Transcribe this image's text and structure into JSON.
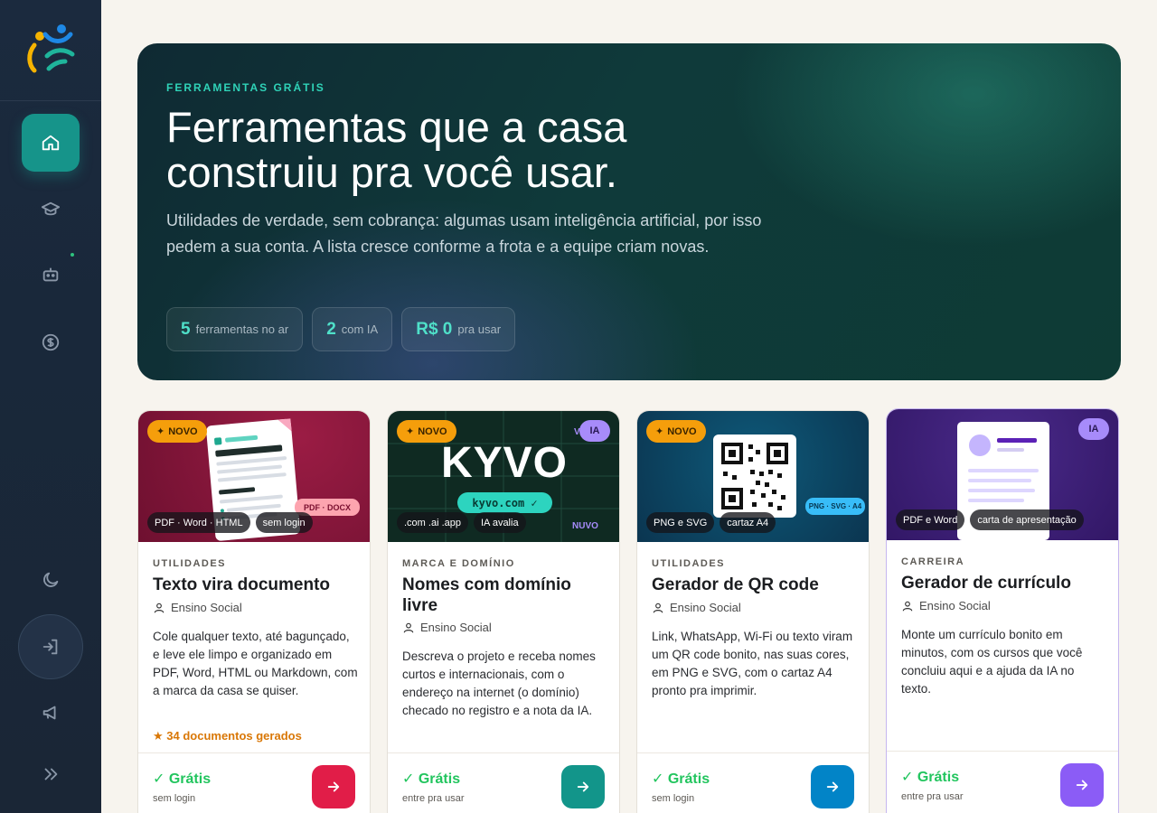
{
  "colors": {
    "accent": "#16948a",
    "price": "#22c55e",
    "badge_new": "#f59e0b",
    "badge_ia": "#a78bfa"
  },
  "sidebar": {
    "items": [
      {
        "icon": "home-icon",
        "active": true
      },
      {
        "icon": "graduation-cap-icon"
      },
      {
        "icon": "robot-icon"
      },
      {
        "icon": "dollar-icon"
      }
    ],
    "bottom": [
      "moon-icon",
      "logout-icon",
      "megaphone-icon",
      "chevrons-right-icon"
    ]
  },
  "hero": {
    "eyebrow": "FERRAMENTAS GRÁTIS",
    "title_line1": "Ferramentas que a casa",
    "title_line2": "construiu pra você usar.",
    "subtitle": "Utilidades de verdade, sem cobrança: algumas usam inteligência artificial, por isso pedem a sua conta. A lista cresce conforme a frota e a equipe criam novas.",
    "stats": [
      {
        "value": "5",
        "label": "ferramentas no ar"
      },
      {
        "value": "2",
        "label": "com IA"
      },
      {
        "value": "R$ 0",
        "label": "pra usar"
      }
    ]
  },
  "cards": [
    {
      "badge": "NOVO",
      "chips": [
        "PDF · Word · HTML",
        "sem login"
      ],
      "banner_tag": "PDF · DOCX",
      "category": "UTILIDADES",
      "title": "Texto vira documento",
      "author": "Ensino Social",
      "description": "Cole qualquer texto, até bagunçado, e leve ele limpo e organizado em PDF, Word, HTML ou Markdown, com a marca da casa se quiser.",
      "stat": "★ 34 documentos gerados",
      "price": "✓ Grátis",
      "note": "sem login",
      "button_color": "#e11d48"
    },
    {
      "badge": "NOVO",
      "ia": "IA",
      "brand": "KYVO",
      "domain_pill": "kyvo.com ✓",
      "side_text_top": "V",
      "side_text_bottom": "NUVO",
      "chips": [
        ".com .ai .app",
        "IA avalia"
      ],
      "category": "MARCA E DOMÍNIO",
      "title": "Nomes com domínio livre",
      "author": "Ensino Social",
      "description": "Descreva o projeto e receba nomes curtos e internacionais, com o endereço na internet (o domínio) checado no registro e a nota da IA.",
      "price": "✓ Grátis",
      "note": "entre pra usar",
      "button_color": "#12958a"
    },
    {
      "badge": "NOVO",
      "chips": [
        "PNG e SVG",
        "cartaz A4"
      ],
      "banner_tag": "PNG · SVG · A4",
      "category": "UTILIDADES",
      "title": "Gerador de QR code",
      "author": "Ensino Social",
      "description": "Link, WhatsApp, Wi-Fi ou texto viram um QR code bonito, nas suas cores, em PNG e SVG, com o cartaz A4 pronto pra imprimir.",
      "price": "✓ Grátis",
      "note": "sem login",
      "button_color": "#0284c7"
    },
    {
      "ia": "IA",
      "chips": [
        "PDF e Word",
        "carta de apresentação"
      ],
      "category": "CARREIRA",
      "title": "Gerador de currículo",
      "author": "Ensino Social",
      "description": "Monte um currículo bonito em minutos, com os cursos que você concluiu aqui e a ajuda da IA no texto.",
      "price": "✓ Grátis",
      "note": "entre pra usar",
      "button_color": "#8b5cf6"
    }
  ]
}
